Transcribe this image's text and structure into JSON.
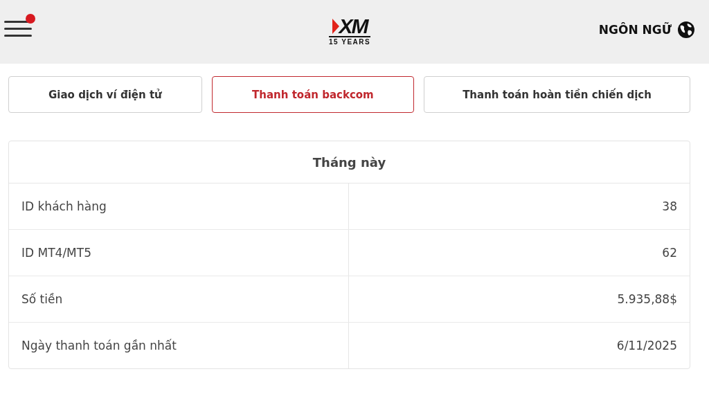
{
  "header": {
    "menu_badge": true,
    "logo": {
      "mark": "XM",
      "tagline": "15 YEARS"
    },
    "language": "NGÔN NGỮ"
  },
  "tabs": [
    {
      "label": "Giao dịch ví điện tử",
      "selected": false
    },
    {
      "label": "Thanh toán backcom",
      "selected": true
    },
    {
      "label": "Thanh toán hoàn tiền chiến dịch",
      "selected": false
    }
  ],
  "table": {
    "title": "Tháng này",
    "rows": [
      {
        "label": "ID khách hàng",
        "value": "38"
      },
      {
        "label": "ID MT4/MT5",
        "value": "62"
      },
      {
        "label": "Số tiền",
        "value": "5.935,88$"
      },
      {
        "label": "Ngày thanh toán gần nhất",
        "value": "6/11/2025"
      }
    ]
  }
}
